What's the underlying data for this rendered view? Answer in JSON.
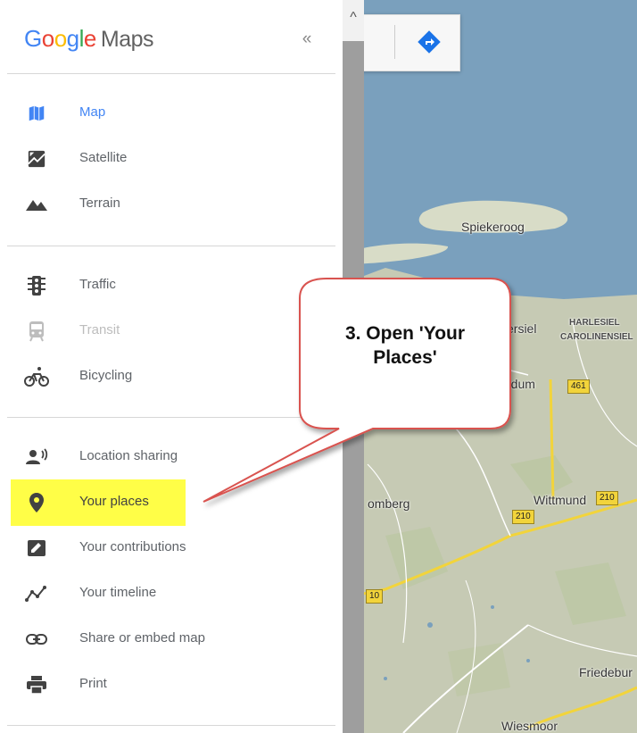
{
  "app": {
    "brand_letters": [
      "G",
      "o",
      "o",
      "g",
      "l",
      "e"
    ],
    "brand_suffix": "Maps",
    "collapse_glyph": "«",
    "scroll_up_glyph": "^"
  },
  "menu": {
    "map_types": [
      {
        "label": "Map",
        "icon": "map-icon",
        "active": true
      },
      {
        "label": "Satellite",
        "icon": "satellite-icon"
      },
      {
        "label": "Terrain",
        "icon": "terrain-icon"
      }
    ],
    "layers": [
      {
        "label": "Traffic",
        "icon": "traffic-icon"
      },
      {
        "label": "Transit",
        "icon": "transit-icon",
        "disabled": true
      },
      {
        "label": "Bicycling",
        "icon": "bicycling-icon"
      }
    ],
    "personal": [
      {
        "label": "Location sharing",
        "icon": "location-sharing-icon"
      },
      {
        "label": "Your places",
        "icon": "place-pin-icon",
        "highlighted": true
      },
      {
        "label": "Your contributions",
        "icon": "contributions-icon"
      },
      {
        "label": "Your timeline",
        "icon": "timeline-icon"
      },
      {
        "label": "Share or embed map",
        "icon": "link-icon"
      },
      {
        "label": "Print",
        "icon": "print-icon"
      }
    ]
  },
  "map": {
    "labels": {
      "spiekeroog": "Spiekeroog",
      "harlesiel": "HARLESIEL",
      "carolinensiel": "CAROLINENSIEL",
      "ersiel": "ersiel",
      "rdum": "rdum",
      "omberg": "omberg",
      "wittmund": "Wittmund",
      "friedebur": "Friedebur",
      "wiesmoor": "Wiesmoor"
    },
    "road_shields": {
      "r461": "461",
      "r210a": "210",
      "r210b": "210",
      "r10": "10"
    }
  },
  "callout": {
    "line1": "3. Open 'Your",
    "line2": "Places'"
  },
  "colors": {
    "accent": "#4285F4",
    "water": "#7aa0bd",
    "land": "#c9cdb9",
    "highlight": "#fffe47",
    "callout_border": "#d9534f"
  }
}
